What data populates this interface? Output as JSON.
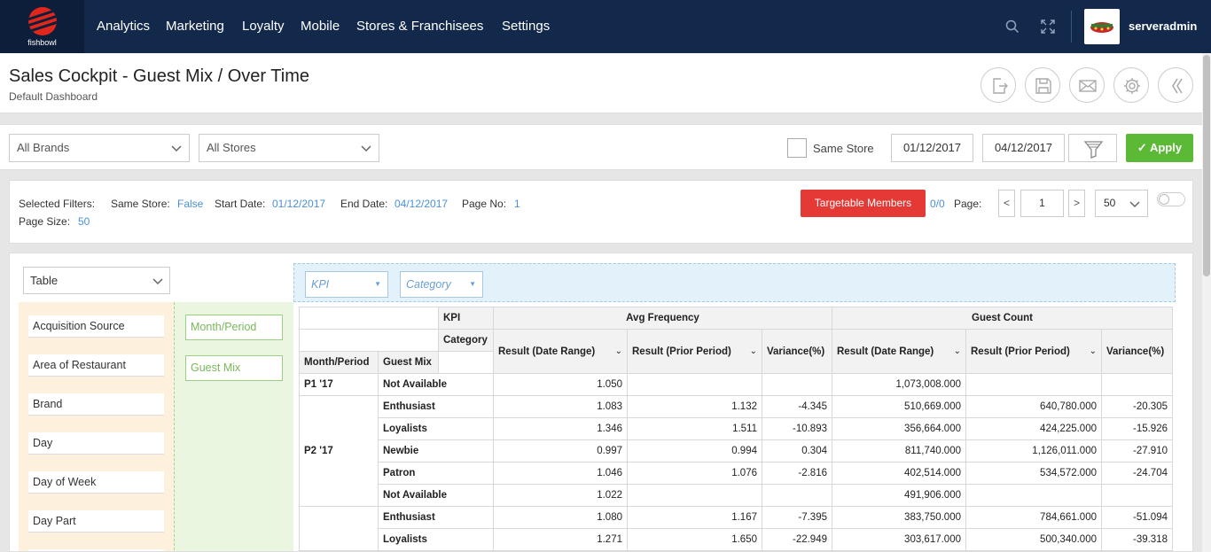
{
  "brand": {
    "logo_text": "fishbowl"
  },
  "nav": {
    "items": [
      "Analytics",
      "Marketing",
      "Loyalty",
      "Mobile",
      "Stores & Franchisees",
      "Settings"
    ],
    "username": "serveradmin"
  },
  "header": {
    "title": "Sales Cockpit - Guest Mix / Over Time",
    "subtitle": "Default Dashboard"
  },
  "filters": {
    "brands": "All Brands",
    "stores": "All Stores",
    "same_store_label": "Same Store",
    "start_date": "01/12/2017",
    "end_date": "04/12/2017",
    "apply_label": "Apply"
  },
  "selected": {
    "label": "Selected Filters:",
    "same_store_label": "Same Store:",
    "same_store_value": "False",
    "start_label": "Start Date:",
    "start_value": "01/12/2017",
    "end_label": "End Date:",
    "end_value": "04/12/2017",
    "page_no_label": "Page No:",
    "page_no_value": "1",
    "page_size_label": "Page Size:",
    "page_size_value": "50",
    "targetable_label": "Targetable Members",
    "targetable_count": "0/0",
    "page_label": "Page:",
    "prev": "<",
    "page_value": "1",
    "next": ">",
    "size_select": "50"
  },
  "pivot": {
    "renderer": "Table",
    "unused_fields": [
      "Acquisition Source",
      "Area of Restaurant",
      "Brand",
      "Day",
      "Day of Week",
      "Day Part"
    ],
    "row_fields": [
      "Month/Period",
      "Guest Mix"
    ],
    "col_fields": [
      "KPI",
      "Category"
    ],
    "header": {
      "kpi": "KPI",
      "category": "Category",
      "month": "Month/Period",
      "guest_mix": "Guest Mix",
      "group1": "Avg Frequency",
      "group2": "Guest Count",
      "res_date": "Result (Date Range)",
      "res_prior": "Result (Prior Period)",
      "variance": "Variance(%)"
    },
    "rows": [
      {
        "period": "P1 '17",
        "mix": "Not Available",
        "v": [
          "1.050",
          "",
          "",
          "1,073,008.000",
          "",
          ""
        ]
      },
      {
        "period": "P2 '17",
        "mix": "Enthusiast",
        "v": [
          "1.083",
          "1.132",
          "-4.345",
          "510,669.000",
          "640,780.000",
          "-20.305"
        ]
      },
      {
        "period": "",
        "mix": "Loyalists",
        "v": [
          "1.346",
          "1.511",
          "-10.893",
          "356,664.000",
          "424,225.000",
          "-15.926"
        ]
      },
      {
        "period": "",
        "mix": "Newbie",
        "v": [
          "0.997",
          "0.994",
          "0.304",
          "811,740.000",
          "1,126,011.000",
          "-27.910"
        ]
      },
      {
        "period": "",
        "mix": "Patron",
        "v": [
          "1.046",
          "1.076",
          "-2.816",
          "402,514.000",
          "534,572.000",
          "-24.704"
        ]
      },
      {
        "period": "",
        "mix": "Not Available",
        "v": [
          "1.022",
          "",
          "",
          "491,906.000",
          "",
          ""
        ]
      },
      {
        "period": "",
        "mix": "Enthusiast",
        "v": [
          "1.080",
          "1.167",
          "-7.395",
          "383,750.000",
          "784,661.000",
          "-51.094"
        ]
      },
      {
        "period": "",
        "mix": "Loyalists",
        "v": [
          "1.271",
          "1.650",
          "-22.949",
          "303,617.000",
          "500,340.000",
          "-39.318"
        ]
      }
    ]
  },
  "colors": {
    "nav_bg": "#13294b",
    "apply": "#5cb936",
    "targetable": "#e53935",
    "link": "#4a90d9"
  }
}
